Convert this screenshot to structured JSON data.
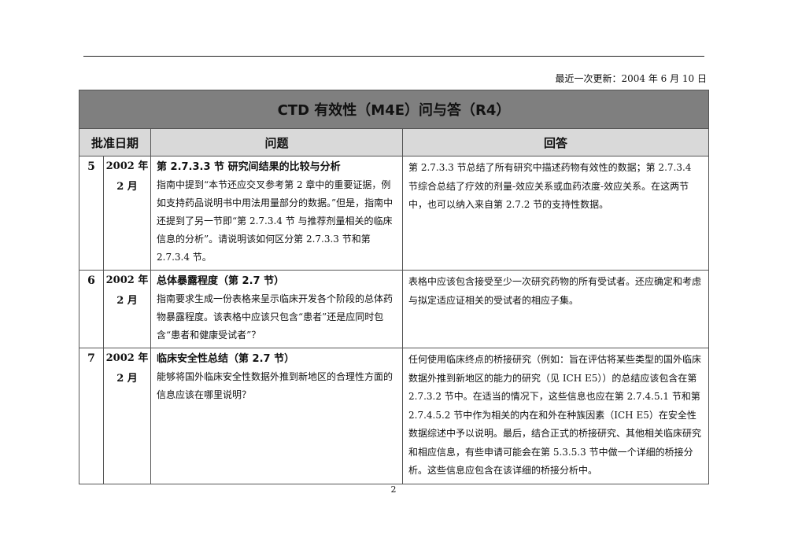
{
  "header": {
    "last_updated": "最近一次更新：2004 年 6 月 10 日"
  },
  "table": {
    "title": "CTD 有效性（M4E）问与答（R4）",
    "columns": [
      "批准日期",
      "问题",
      "回答"
    ],
    "rows": [
      {
        "num": "5",
        "date_line1": "2002 年",
        "date_line2": "2 月",
        "question_title": "第 2.7.3.3 节 研究间结果的比较与分析",
        "question_body": "指南中提到“本节还应交叉参考第 2 章中的重要证据，例如支持药品说明书中用法用量部分的数据。”但是，指南中还提到了另一节即“第 2.7.3.4 节 与推荐剂量相关的临床信息的分析”。请说明该如何区分第 2.7.3.3 节和第 2.7.3.4 节。",
        "answer": "第 2.7.3.3 节总结了所有研究中描述药物有效性的数据；第 2.7.3.4 节综合总结了疗效的剂量-效应关系或血药浓度-效应关系。在这两节中，也可以纳入来自第 2.7.2 节的支持性数据。"
      },
      {
        "num": "6",
        "date_line1": "2002 年",
        "date_line2": "2 月",
        "question_title": "总体暴露程度（第 2.7 节）",
        "question_body": "指南要求生成一份表格来呈示临床开发各个阶段的总体药物暴露程度。该表格中应该只包含“患者”还是应同时包含“患者和健康受试者”？",
        "answer": "表格中应该包含接受至少一次研究药物的所有受试者。还应确定和考虑与拟定适应证相关的受试者的相应子集。"
      },
      {
        "num": "7",
        "date_line1": "2002 年",
        "date_line2": "2 月",
        "question_title": "临床安全性总结（第 2.7 节）",
        "question_body": "能够将国外临床安全性数据外推到新地区的合理性方面的信息应该在哪里说明？",
        "answer": "任何使用临床终点的桥接研究（例如：旨在评估将某些类型的国外临床数据外推到新地区的能力的研究（见 ICH E5））的总结应该包含在第 2.7.3.2 节中。在适当的情况下，这些信息也应在第 2.7.4.5.1 节和第 2.7.4.5.2 节中作为相关的内在和外在种族因素（ICH E5）在安全性数据综述中予以说明。最后，结合正式的桥接研究、其他相关临床研究和相应信息，有些申请可能会在第 5.3.5.3 节中做一个详细的桥接分析。这些信息应包含在该详细的桥接分析中。"
      }
    ]
  },
  "footer": {
    "page_number": "2"
  }
}
